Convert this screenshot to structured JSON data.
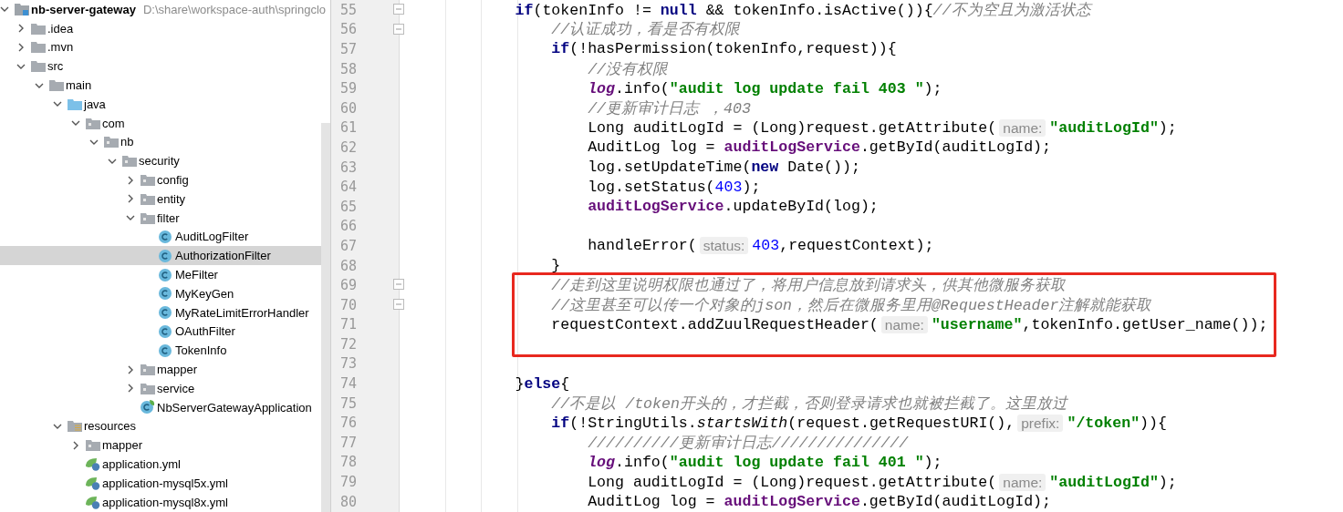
{
  "project_tree": {
    "items": [
      {
        "name": "nb-server-gateway",
        "kind": "module",
        "path": "D:\\share\\workspace-auth\\springclo",
        "expanded": true,
        "selected": false,
        "children": [
          {
            "name": ".idea",
            "kind": "folder",
            "expanded": false,
            "selected": false
          },
          {
            "name": ".mvn",
            "kind": "folder",
            "expanded": false,
            "selected": false
          },
          {
            "name": "src",
            "kind": "folder",
            "expanded": true,
            "selected": false,
            "children": [
              {
                "name": "main",
                "kind": "folder",
                "expanded": true,
                "selected": false,
                "children": [
                  {
                    "name": "java",
                    "kind": "source",
                    "expanded": true,
                    "selected": false,
                    "children": [
                      {
                        "name": "com",
                        "kind": "package",
                        "expanded": true,
                        "selected": false,
                        "children": [
                          {
                            "name": "nb",
                            "kind": "package",
                            "expanded": true,
                            "selected": false,
                            "children": [
                              {
                                "name": "security",
                                "kind": "package",
                                "expanded": true,
                                "selected": false,
                                "children": [
                                  {
                                    "name": "config",
                                    "kind": "package",
                                    "expanded": false,
                                    "selected": false
                                  },
                                  {
                                    "name": "entity",
                                    "kind": "package",
                                    "expanded": false,
                                    "selected": false
                                  },
                                  {
                                    "name": "filter",
                                    "kind": "package",
                                    "expanded": true,
                                    "selected": false,
                                    "children": [
                                      {
                                        "name": "AuditLogFilter",
                                        "kind": "class",
                                        "selected": false
                                      },
                                      {
                                        "name": "AuthorizationFilter",
                                        "kind": "class",
                                        "selected": true
                                      },
                                      {
                                        "name": "MeFilter",
                                        "kind": "class",
                                        "selected": false
                                      },
                                      {
                                        "name": "MyKeyGen",
                                        "kind": "class",
                                        "selected": false
                                      },
                                      {
                                        "name": "MyRateLimitErrorHandler",
                                        "kind": "class",
                                        "selected": false
                                      },
                                      {
                                        "name": "OAuthFilter",
                                        "kind": "class",
                                        "selected": false
                                      },
                                      {
                                        "name": "TokenInfo",
                                        "kind": "class",
                                        "selected": false
                                      }
                                    ]
                                  },
                                  {
                                    "name": "mapper",
                                    "kind": "package",
                                    "expanded": false,
                                    "selected": false
                                  },
                                  {
                                    "name": "service",
                                    "kind": "package",
                                    "expanded": false,
                                    "selected": false
                                  },
                                  {
                                    "name": "NbServerGatewayApplication",
                                    "kind": "spring_class",
                                    "selected": false
                                  }
                                ]
                              }
                            ]
                          }
                        ]
                      }
                    ]
                  },
                  {
                    "name": "resources",
                    "kind": "resources",
                    "expanded": true,
                    "selected": false,
                    "children": [
                      {
                        "name": "mapper",
                        "kind": "package",
                        "expanded": false,
                        "selected": false
                      },
                      {
                        "name": "application.yml",
                        "kind": "yml",
                        "selected": false
                      },
                      {
                        "name": "application-mysql5x.yml",
                        "kind": "yml",
                        "selected": false
                      },
                      {
                        "name": "application-mysql8x.yml",
                        "kind": "yml",
                        "selected": false
                      }
                    ]
                  }
                ]
              }
            ]
          }
        ]
      }
    ]
  },
  "editor": {
    "lines": [
      {
        "number": "55",
        "fold": true,
        "tokens": [
          {
            "kind": "keyword",
            "text": "            if"
          },
          {
            "kind": "plain",
            "text": "(tokenInfo != "
          },
          {
            "kind": "keyword",
            "text": "null"
          },
          {
            "kind": "plain",
            "text": " && tokenInfo.isActive()){"
          },
          {
            "kind": "comment",
            "text": "//不为空且为激活状态"
          }
        ]
      },
      {
        "number": "56",
        "fold": true,
        "tokens": [
          {
            "kind": "comment",
            "text": "                //认证成功，看是否有权限"
          }
        ]
      },
      {
        "number": "57",
        "tokens": [
          {
            "kind": "keyword",
            "text": "                if"
          },
          {
            "kind": "plain",
            "text": "(!hasPermission(tokenInfo,request)){"
          }
        ]
      },
      {
        "number": "58",
        "tokens": [
          {
            "kind": "comment",
            "text": "                    //没有权限"
          }
        ]
      },
      {
        "number": "59",
        "tokens": [
          {
            "kind": "static_field",
            "text": "                    log"
          },
          {
            "kind": "plain",
            "text": ".info("
          },
          {
            "kind": "string",
            "text": "\"audit log update fail 403 \""
          },
          {
            "kind": "plain",
            "text": ");"
          }
        ]
      },
      {
        "number": "60",
        "tokens": [
          {
            "kind": "comment",
            "text": "                    //更新审计日志 ，403"
          }
        ]
      },
      {
        "number": "61",
        "tokens": [
          {
            "kind": "plain",
            "text": "                    Long auditLogId = (Long)request.getAttribute("
          },
          {
            "kind": "hint",
            "text": "name:"
          },
          {
            "kind": "string",
            "text": "\"auditLogId\""
          },
          {
            "kind": "plain",
            "text": ");"
          }
        ]
      },
      {
        "number": "62",
        "tokens": [
          {
            "kind": "plain",
            "text": "                    AuditLog log = "
          },
          {
            "kind": "field",
            "text": "auditLogService"
          },
          {
            "kind": "plain",
            "text": ".getById(auditLogId);"
          }
        ]
      },
      {
        "number": "63",
        "tokens": [
          {
            "kind": "plain",
            "text": "                    log.setUpdateTime("
          },
          {
            "kind": "keyword",
            "text": "new"
          },
          {
            "kind": "plain",
            "text": " Date());"
          }
        ]
      },
      {
        "number": "64",
        "tokens": [
          {
            "kind": "plain",
            "text": "                    log.setStatus("
          },
          {
            "kind": "number",
            "text": "403"
          },
          {
            "kind": "plain",
            "text": ");"
          }
        ]
      },
      {
        "number": "65",
        "tokens": [
          {
            "kind": "field",
            "text": "                    auditLogService"
          },
          {
            "kind": "plain",
            "text": ".updateById(log);"
          }
        ]
      },
      {
        "number": "66"
      },
      {
        "number": "67",
        "tokens": [
          {
            "kind": "plain",
            "text": "                    handleError("
          },
          {
            "kind": "hint",
            "text": "status:"
          },
          {
            "kind": "number",
            "text": "403"
          },
          {
            "kind": "plain",
            "text": ",requestContext);"
          }
        ]
      },
      {
        "number": "68",
        "tokens": [
          {
            "kind": "plain",
            "text": "                }"
          }
        ]
      },
      {
        "number": "69",
        "fold": true,
        "highlighted": true,
        "tokens": [
          {
            "kind": "comment",
            "text": "                //走到这里说明权限也通过了，将用户信息放到请求头，供其他微服务获取"
          }
        ]
      },
      {
        "number": "70",
        "fold": true,
        "highlighted": true,
        "tokens": [
          {
            "kind": "comment",
            "text": "                //这里甚至可以传一个对象的json，然后在微服务里用@RequestHeader注解就能获取"
          }
        ]
      },
      {
        "number": "71",
        "highlighted": true,
        "tokens": [
          {
            "kind": "plain",
            "text": "                requestContext.addZuulRequestHeader("
          },
          {
            "kind": "hint",
            "text": "name:"
          },
          {
            "kind": "string",
            "text": "\"username\""
          },
          {
            "kind": "plain",
            "text": ",tokenInfo.getUser_name());"
          }
        ]
      },
      {
        "number": "72",
        "highlighted": true
      },
      {
        "number": "73"
      },
      {
        "number": "74",
        "tokens": [
          {
            "kind": "plain",
            "text": "            }"
          },
          {
            "kind": "keyword",
            "text": "else"
          },
          {
            "kind": "plain",
            "text": "{"
          }
        ]
      },
      {
        "number": "75",
        "tokens": [
          {
            "kind": "comment",
            "text": "                //不是以 /token开头的，才拦截，否则登录请求也就被拦截了。这里放过"
          }
        ]
      },
      {
        "number": "76",
        "tokens": [
          {
            "kind": "keyword",
            "text": "                if"
          },
          {
            "kind": "plain",
            "text": "(!StringUtils."
          },
          {
            "kind": "static_method",
            "text": "startsWith"
          },
          {
            "kind": "plain",
            "text": "(request.getRequestURI(),"
          },
          {
            "kind": "hint",
            "text": "prefix:"
          },
          {
            "kind": "string",
            "text": "\"/token\""
          },
          {
            "kind": "plain",
            "text": ")){"
          }
        ]
      },
      {
        "number": "77",
        "tokens": [
          {
            "kind": "comment",
            "text": "                    //////////更新审计日志///////////////"
          }
        ]
      },
      {
        "number": "78",
        "tokens": [
          {
            "kind": "static_field",
            "text": "                    log"
          },
          {
            "kind": "plain",
            "text": ".info("
          },
          {
            "kind": "string",
            "text": "\"audit log update fail 401 \""
          },
          {
            "kind": "plain",
            "text": ");"
          }
        ]
      },
      {
        "number": "79",
        "tokens": [
          {
            "kind": "plain",
            "text": "                    Long auditLogId = (Long)request.getAttribute("
          },
          {
            "kind": "hint",
            "text": "name:"
          },
          {
            "kind": "string",
            "text": "\"auditLogId\""
          },
          {
            "kind": "plain",
            "text": ");"
          }
        ]
      },
      {
        "number": "80",
        "tokens": [
          {
            "kind": "plain",
            "text": "                    AuditLog log = "
          },
          {
            "kind": "field",
            "text": "auditLogService"
          },
          {
            "kind": "plain",
            "text": ".getById(auditLogId);"
          }
        ]
      }
    ]
  }
}
